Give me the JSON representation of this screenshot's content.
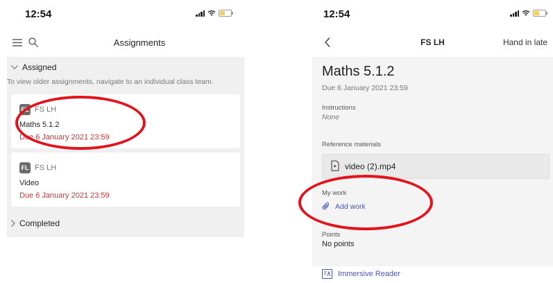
{
  "left": {
    "status": {
      "time": "12:54"
    },
    "header": {
      "title": "Assignments"
    },
    "assigned_label": "Assigned",
    "hint": "To view older assignments, navigate to an individual class team.",
    "cards": [
      {
        "badge": "FL",
        "class": "FS LH",
        "name": "Maths 5.1.2",
        "due": "Due 6 January 2021 23:59"
      },
      {
        "badge": "FL",
        "class": "FS LH",
        "name": "Video",
        "due": "Due 6 January 2021 23:59"
      }
    ],
    "completed_label": "Completed"
  },
  "right": {
    "status": {
      "time": "12:54"
    },
    "header": {
      "title": "FS LH",
      "hand_in_late": "Hand in late"
    },
    "title": "Maths 5.1.2",
    "due": "Due 6 January 2021 23:59",
    "instructions_label": "Instructions",
    "instructions_value": "None",
    "reference_label": "Reference materials",
    "file_name": "video (2).mp4",
    "my_work_label": "My work",
    "add_work": "Add work",
    "points_label": "Points",
    "points_value": "No points",
    "immersive_reader": "Immersive Reader"
  },
  "colors": {
    "annotation": "#e3131b",
    "link": "#4b53bc",
    "due": "#b83b3b"
  }
}
